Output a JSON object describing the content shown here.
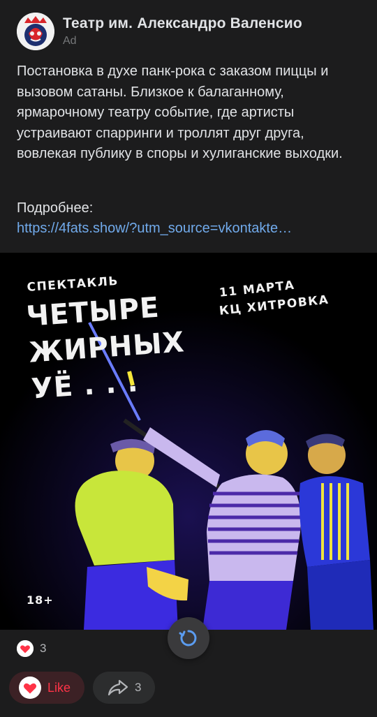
{
  "post": {
    "author": "Театр им. Александро Валенсио",
    "ad_label": "Ad",
    "text": "Постановка в духе панк-рока с заказом пиццы и вызовом сатаны. Близкое к балаганному, ярмарочному театру событие, где артисты устраивают спарринги и троллят друг друга, вовлекая публику в споры и хулиганские выходки.",
    "more_label": "Подробнее:",
    "link": "https://4fats.show/?utm_source=vkontakte…"
  },
  "poster": {
    "label": "СПЕКТАКЛЬ",
    "title_line1": "ЧЕТЫРЕ",
    "title_line2": "ЖИРНЫХ",
    "title_line3": "УЁ . . .",
    "date": "11 МАРТА",
    "venue": "КЦ ХИТРОВКА",
    "age": "18+"
  },
  "actions": {
    "likes_count": "3",
    "like_label": "Like",
    "share_count": "3"
  },
  "colors": {
    "background": "#1c1c1d",
    "link": "#71aaeb",
    "like_red": "#ff3347",
    "loader_blue": "#5b9cf0"
  },
  "icons": {
    "like": "heart-icon",
    "share": "share-arrow-icon",
    "loading": "refresh-spinner-icon"
  }
}
